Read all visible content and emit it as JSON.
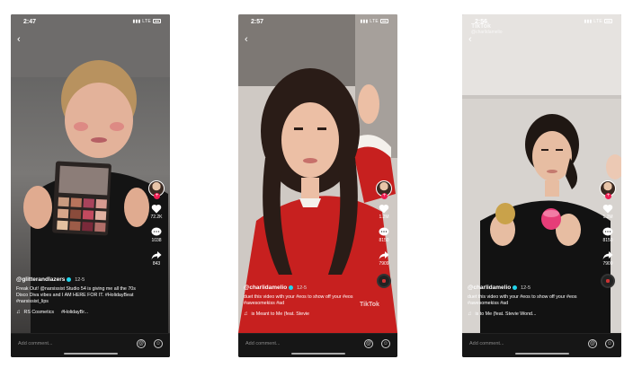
{
  "phones": [
    {
      "status_time": "2:47",
      "status_net": "LTE",
      "counts": {
        "likes": "72.2K",
        "comments": "1038",
        "shares": "843"
      },
      "caption": {
        "handle": "@glitterandlazers",
        "date": "12-5",
        "text": "Freak Out! @narsissist Studio 54 is giving me all the 70s Disco Diva vibes and I AM HERE FOR IT. #HolidayBeat #narsissist_lips",
        "sound": "RS Cosmetics",
        "sound_extra": "#HolidayBr..."
      },
      "comment_placeholder": "Add comment...",
      "watermark": ""
    },
    {
      "status_time": "2:57",
      "status_net": "LTE",
      "counts": {
        "likes": "1.2M",
        "comments": "8150",
        "shares": "7909"
      },
      "caption": {
        "handle": "@charlidamelio",
        "date": "12-5",
        "text": "duet this video with your #eos to show off your #eos #awesomekiss #ad",
        "sound": "is Meant to Me (feat. Stevie",
        "sound_extra": ""
      },
      "comment_placeholder": "Add comment...",
      "watermark": "TikTok"
    },
    {
      "status_time": "2:56",
      "status_net": "LTE",
      "counts": {
        "likes": "1.2M",
        "comments": "8150",
        "shares": "7909"
      },
      "caption": {
        "handle": "@charlidamelio",
        "date": "12-5",
        "text": "duet this video with your #eos to show off your #eos #awesomekiss #ad",
        "sound": "is to Me (feat. Stevie Wond...",
        "sound_extra": ""
      },
      "comment_placeholder": "Add comment...",
      "watermark": "TikTok",
      "watermark_sub": "@charlidamelio"
    }
  ],
  "icons": {
    "back": "chevron-left-icon",
    "like": "heart-icon",
    "comment": "comment-bubble-icon",
    "share": "share-arrow-icon",
    "mention": "at-sign-icon",
    "emoji": "emoji-icon"
  },
  "colors": {
    "accent": "#ee1d52",
    "verified": "#20d5ec",
    "bar": "#161616"
  }
}
